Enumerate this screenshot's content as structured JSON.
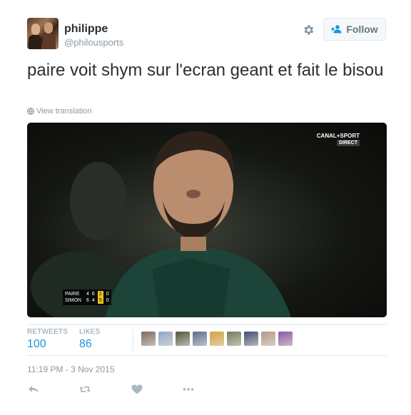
{
  "user": {
    "name": "philippe",
    "handle": "@philousports"
  },
  "follow_button": {
    "label": "Follow"
  },
  "tweet": {
    "text": "paire voit shym sur l'ecran geant et fait le bisou",
    "translation_link": "View translation",
    "timestamp": "11:19 PM - 3 Nov 2015"
  },
  "media": {
    "broadcaster": "CANAL+SPORT",
    "broadcast_status": "DIRECT",
    "scoreboard": [
      {
        "player": "PAIRE",
        "sets": [
          "4",
          "6",
          "1"
        ],
        "points": "0"
      },
      {
        "player": "SIMON",
        "sets": [
          "6",
          "4",
          "5"
        ],
        "points": "0"
      }
    ]
  },
  "stats": {
    "retweets_label": "RETWEETS",
    "retweets_count": "100",
    "likes_label": "LIKES",
    "likes_count": "86"
  },
  "likers": [
    {
      "icon": "liker-avatar",
      "color": "#7a6a5e"
    },
    {
      "icon": "liker-avatar",
      "color": "#8fa9c4"
    },
    {
      "icon": "liker-avatar",
      "color": "#4c5a3b"
    },
    {
      "icon": "liker-avatar",
      "color": "#5b6f8f"
    },
    {
      "icon": "liker-avatar",
      "color": "#d6a23c"
    },
    {
      "icon": "liker-avatar",
      "color": "#6e7d5a"
    },
    {
      "icon": "liker-avatar",
      "color": "#3f4f6e"
    },
    {
      "icon": "liker-avatar",
      "color": "#b29a8a"
    },
    {
      "icon": "liker-avatar",
      "color": "#8a5aa0"
    }
  ],
  "actions": [
    {
      "name": "reply-icon"
    },
    {
      "name": "retweet-icon"
    },
    {
      "name": "like-icon"
    },
    {
      "name": "more-icon"
    }
  ],
  "colors": {
    "link_blue": "#1b95e0",
    "muted_gray": "#8899a6",
    "text_dark": "#292f33"
  }
}
